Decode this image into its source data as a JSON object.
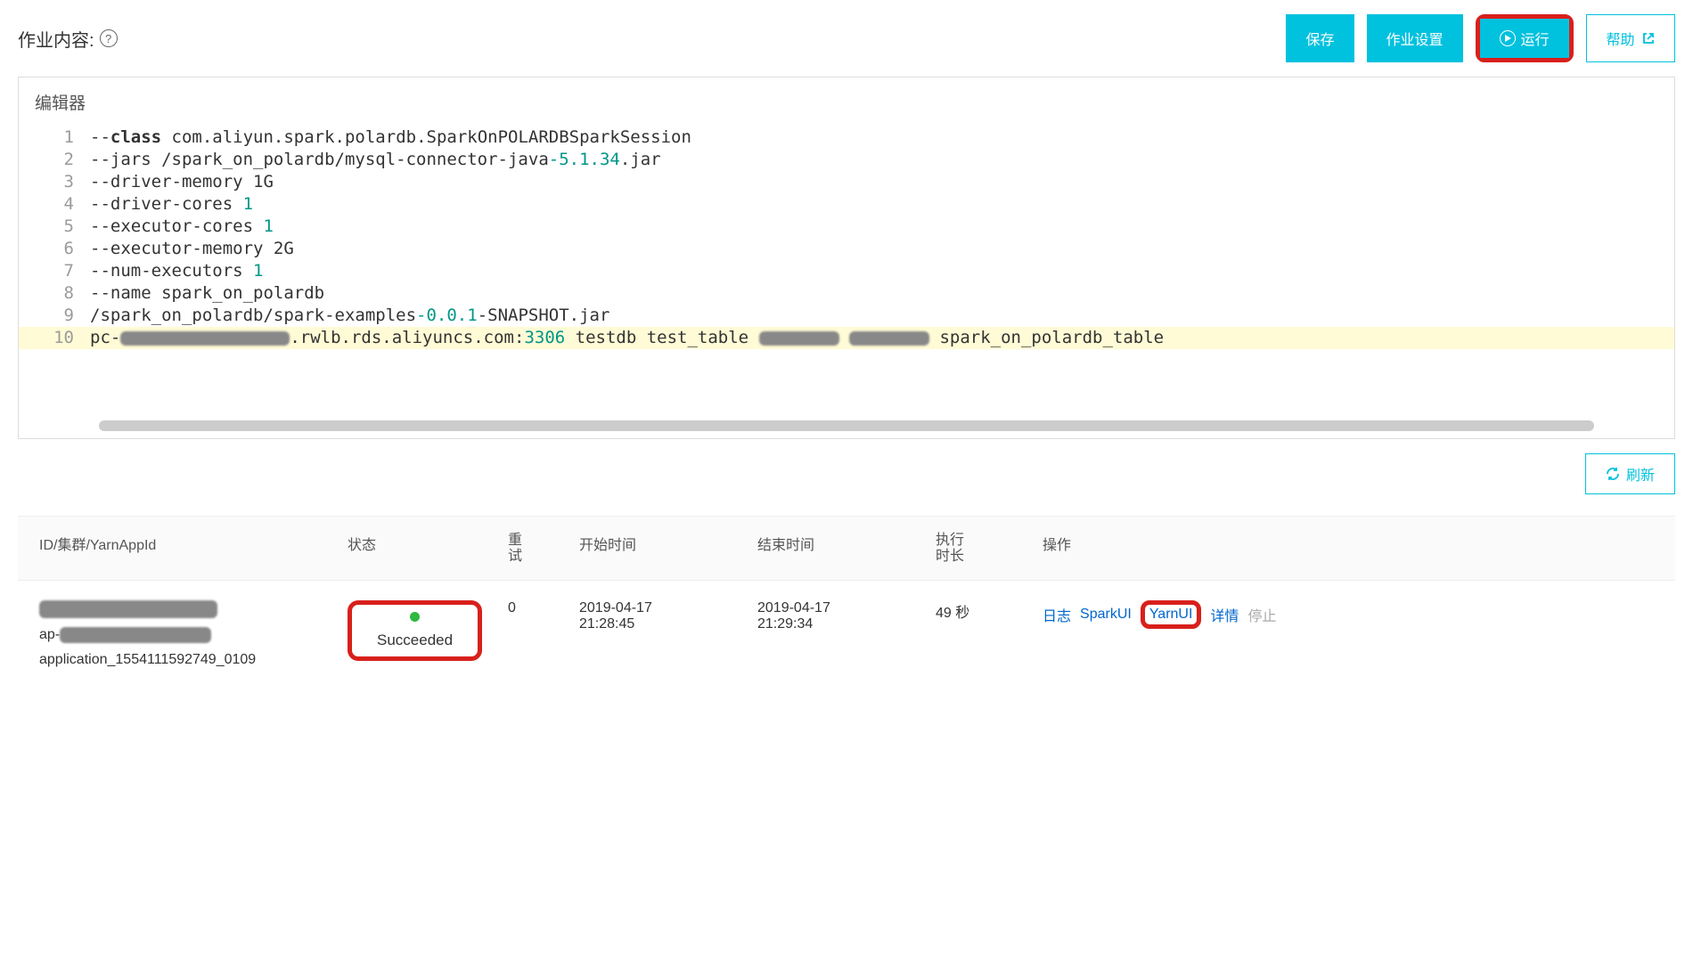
{
  "header": {
    "title": "作业内容:",
    "save": "保存",
    "settings": "作业设置",
    "run": "运行",
    "help": "帮助"
  },
  "editor": {
    "title": "编辑器",
    "lines": {
      "l1_prefix": "--",
      "l1_class": "class",
      "l1_rest": " com.aliyun.spark.polardb.SparkOnPOLARDBSparkSession",
      "l2_a": "--jars /spark_on_polardb/mysql-connector-java",
      "l2_num": "-5.1.34",
      "l2_b": ".jar",
      "l3": "--driver-memory 1G",
      "l4_a": "--driver-cores ",
      "l4_num": "1",
      "l5_a": "--executor-cores ",
      "l5_num": "1",
      "l6": "--executor-memory 2G",
      "l7_a": "--num-executors ",
      "l7_num": "1",
      "l8": "--name spark_on_polardb",
      "l9_a": "/spark_on_polardb/spark-examples",
      "l9_num": "-0.0.1",
      "l9_b": "-SNAPSHOT.jar",
      "l10_a": "pc-",
      "l10_b": ".rwlb.rds.aliyuncs.com:",
      "l10_port": "3306",
      "l10_c": " testdb test_table ",
      "l10_d": " spark_on_polardb_table"
    }
  },
  "refresh": "刷新",
  "table": {
    "headers": {
      "id": "ID/集群/YarnAppId",
      "status": "状态",
      "retry": "重试",
      "start": "开始时间",
      "end": "结束时间",
      "duration": "执行时长",
      "ops": "操作"
    },
    "row": {
      "id_prefix": "ap-",
      "app_id": "application_1554111592749_0109",
      "status": "Succeeded",
      "retry": "0",
      "start": "2019-04-17 21:28:45",
      "end": "2019-04-17 21:29:34",
      "duration": "49 秒",
      "ops": {
        "log": "日志",
        "spark": "SparkUI",
        "yarn": "YarnUI",
        "detail": "详情",
        "stop": "停止"
      }
    }
  }
}
